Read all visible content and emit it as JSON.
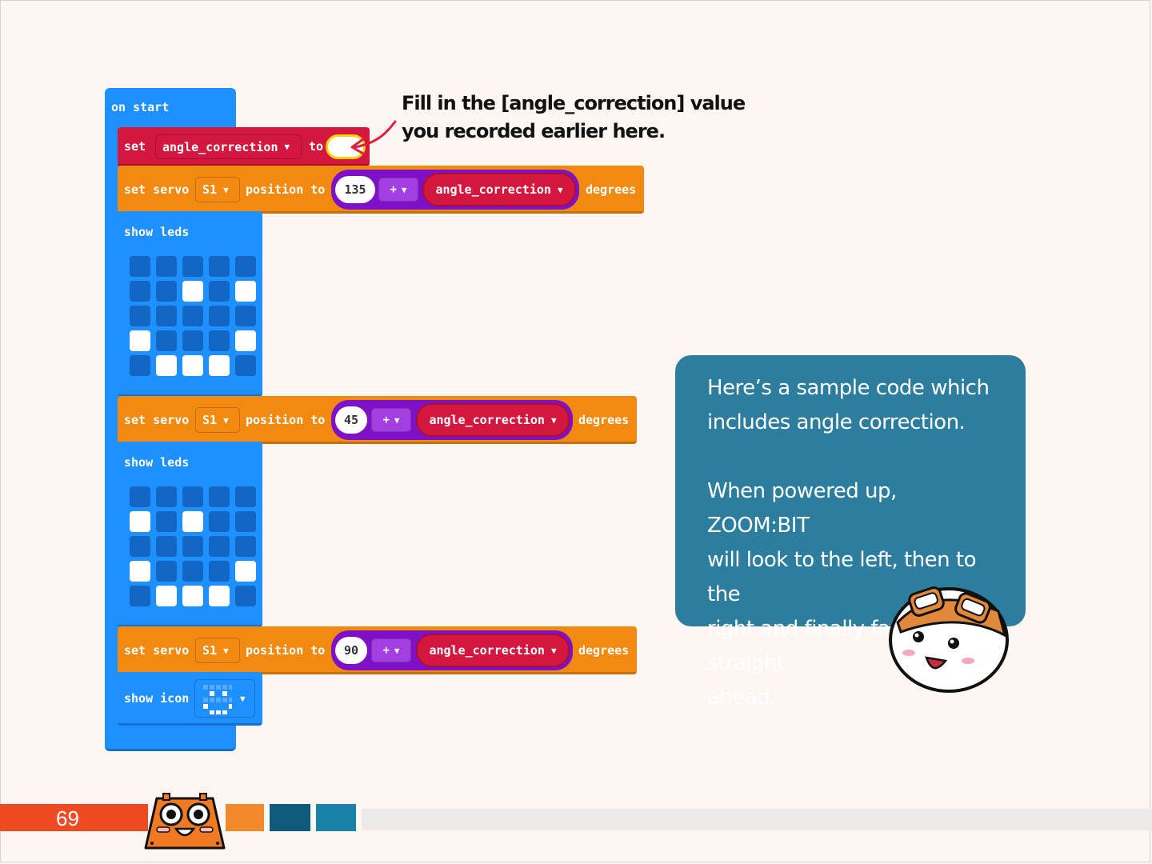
{
  "blocks": {
    "on_start": "on start",
    "set_label": "set",
    "variable": "angle_correction",
    "to_label": "to",
    "set_servo": "set servo",
    "servo_pin": "S1",
    "position_to": "position to",
    "operator": "+",
    "degrees": "degrees",
    "servo_values": [
      "135",
      "45",
      "90"
    ],
    "show_leds": "show leds",
    "show_icon": "show icon",
    "led_grid_1": [
      [
        0,
        0,
        0,
        0,
        0
      ],
      [
        0,
        0,
        1,
        0,
        1
      ],
      [
        0,
        0,
        0,
        0,
        0
      ],
      [
        1,
        0,
        0,
        0,
        1
      ],
      [
        0,
        1,
        1,
        1,
        0
      ]
    ],
    "led_grid_2": [
      [
        0,
        0,
        0,
        0,
        0
      ],
      [
        1,
        0,
        1,
        0,
        0
      ],
      [
        0,
        0,
        0,
        0,
        0
      ],
      [
        1,
        0,
        0,
        0,
        1
      ],
      [
        0,
        1,
        1,
        1,
        0
      ]
    ]
  },
  "annotation": {
    "line1": "Fill in the [angle_correction] value",
    "line2": "you recorded earlier here."
  },
  "info_box": {
    "line1": "Here’s a sample code which",
    "line2": "includes angle correction.",
    "line3": "When powered up, ZOOM:BIT",
    "line4": "will look to the left, then to the",
    "line5": "right and finally face straight",
    "line6": "ahead."
  },
  "footer": {
    "page_number": "69"
  },
  "colors": {
    "event_blue": "#1e90ff",
    "servo_orange": "#f28a12",
    "variable_red": "#d4173f",
    "math_purple": "#7e10c8",
    "info_teal": "#2c7d9e",
    "footer_red": "#ef4b23"
  }
}
